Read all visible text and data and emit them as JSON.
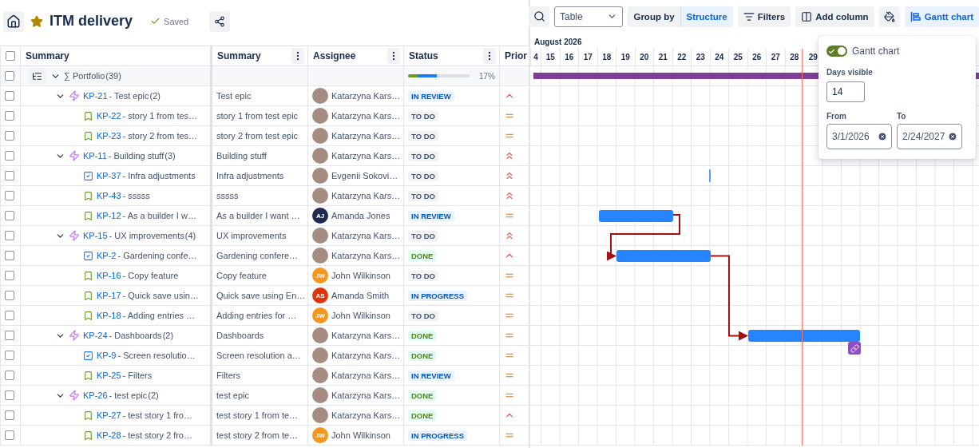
{
  "header": {
    "title": "ITM delivery",
    "starred": true,
    "saved_label": "Saved"
  },
  "toolbar": {
    "view_select": "Table",
    "group_by_label": "Group by",
    "group_by_value": "Structure",
    "filters_label": "Filters",
    "add_column_label": "Add column",
    "gantt_button": {
      "label": "Gantt chart",
      "selected": true
    }
  },
  "table": {
    "header_checked": false,
    "columns": [
      "Summary",
      "Summary",
      "Assignee",
      "Status",
      "Prior"
    ],
    "root": {
      "title": "∑ Portfolio",
      "count": "(39)",
      "checked": false,
      "expanded": true,
      "progress": [
        {
          "kind": "done",
          "level": 0.15
        },
        {
          "kind": "in_progress",
          "level": 0.32
        }
      ],
      "percent": "17%",
      "children": [
        {
          "kind": "epic",
          "key": "KP-21",
          "title": "- Test epic",
          "count": "(2)",
          "summary": "Test epic",
          "assignee": {
            "name": "Katarzyna Kars…",
            "kind": "photo"
          },
          "status": {
            "label": "IN REVIEW",
            "kind": "review"
          },
          "priority": {
            "kind": "high"
          },
          "checked": false,
          "expanded": true,
          "children": [
            {
              "kind": "story",
              "key": "KP-22",
              "title": "- story 1 from tes…",
              "summary": "story 1 from test epic",
              "assignee": {
                "name": "Katarzyna Kars…",
                "kind": "photo"
              },
              "status": {
                "label": "TO DO",
                "kind": "todo"
              },
              "priority": {
                "kind": "medium"
              },
              "checked": false
            },
            {
              "kind": "story",
              "key": "KP-23",
              "title": "- story 2 from tes…",
              "summary": "story 2 from test epic",
              "assignee": {
                "name": "Katarzyna Kars…",
                "kind": "photo"
              },
              "status": {
                "label": "TO DO",
                "kind": "todo"
              },
              "priority": {
                "kind": "medium"
              },
              "checked": false
            }
          ]
        },
        {
          "kind": "epic",
          "key": "KP-11",
          "title": "- Building stuff",
          "count": "(3)",
          "summary": "Building stuff",
          "assignee": {
            "name": "Katarzyna Kars…",
            "kind": "photo"
          },
          "status": {
            "label": "TO DO",
            "kind": "todo"
          },
          "priority": {
            "kind": "highest"
          },
          "checked": false,
          "expanded": true,
          "children": [
            {
              "kind": "task",
              "key": "KP-37",
              "title": "- Infra adjustments",
              "summary": "Infra adjustments",
              "assignee": {
                "name": "Evgenii Sokovi…",
                "kind": "photo"
              },
              "status": {
                "label": "TO DO",
                "kind": "todo"
              },
              "priority": {
                "kind": "highest"
              },
              "checked": false
            },
            {
              "kind": "story",
              "key": "KP-43",
              "title": "- sssss",
              "summary": "sssss",
              "assignee": {
                "name": "Katarzyna Kars…",
                "kind": "photo"
              },
              "status": {
                "label": "TO DO",
                "kind": "todo"
              },
              "priority": {
                "kind": "highest"
              },
              "checked": false
            },
            {
              "kind": "story",
              "key": "KP-12",
              "title": "- As a builder I w…",
              "summary": "As a builder I want …",
              "assignee": {
                "name": "Amanda Jones",
                "kind": "initials",
                "initials": "AJ",
                "color": "#1d2b4f"
              },
              "status": {
                "label": "IN REVIEW",
                "kind": "review"
              },
              "priority": {
                "kind": "medium"
              },
              "checked": false
            }
          ]
        },
        {
          "kind": "epic",
          "key": "KP-15",
          "title": "- UX improvements",
          "count": "(4)",
          "summary": "UX improvements",
          "assignee": {
            "name": "Katarzyna Kars…",
            "kind": "photo"
          },
          "status": {
            "label": "TO DO",
            "kind": "todo"
          },
          "priority": {
            "kind": "highest"
          },
          "checked": false,
          "expanded": true,
          "children": [
            {
              "kind": "task",
              "key": "KP-2",
              "title": "- Gardening confe…",
              "summary": "Gardening confere…",
              "assignee": {
                "name": "Katarzyna Kars…",
                "kind": "photo"
              },
              "status": {
                "label": "DONE",
                "kind": "done"
              },
              "priority": {
                "kind": "high"
              },
              "checked": false
            },
            {
              "kind": "story",
              "key": "KP-16",
              "title": "- Copy feature",
              "summary": "Copy feature",
              "assignee": {
                "name": "John Wilkinson",
                "kind": "initials",
                "initials": "JW",
                "color": "#f5961e"
              },
              "status": {
                "label": "TO DO",
                "kind": "todo"
              },
              "priority": {
                "kind": "medium"
              },
              "checked": false
            },
            {
              "kind": "story",
              "key": "KP-17",
              "title": "- Quick save usin…",
              "summary": "Quick save using En…",
              "assignee": {
                "name": "Amanda Smith",
                "kind": "initials",
                "initials": "AS",
                "color": "#de350b"
              },
              "status": {
                "label": "IN PROGRESS",
                "kind": "progress"
              },
              "priority": {
                "kind": "medium"
              },
              "checked": false
            },
            {
              "kind": "story",
              "key": "KP-18",
              "title": "- Adding entries …",
              "summary": "Adding entries for …",
              "assignee": {
                "name": "John Wilkinson",
                "kind": "initials",
                "initials": "JW",
                "color": "#f5961e"
              },
              "status": {
                "label": "TO DO",
                "kind": "todo"
              },
              "priority": {
                "kind": "medium"
              },
              "checked": false
            }
          ]
        },
        {
          "kind": "epic",
          "key": "KP-24",
          "title": "- Dashboards",
          "count": "(2)",
          "summary": "Dashboards",
          "assignee": {
            "name": "Katarzyna Kars…",
            "kind": "photo"
          },
          "status": {
            "label": "DONE",
            "kind": "done"
          },
          "priority": {
            "kind": "medium"
          },
          "checked": false,
          "expanded": true,
          "children": [
            {
              "kind": "task",
              "key": "KP-9",
              "title": "- Screen resolutio…",
              "summary": "Screen resolution a…",
              "assignee": {
                "name": "Katarzyna Kars…",
                "kind": "photo"
              },
              "status": {
                "label": "DONE",
                "kind": "done"
              },
              "priority": {
                "kind": "medium"
              },
              "checked": false
            },
            {
              "kind": "story",
              "key": "KP-25",
              "title": "- Filters",
              "summary": "Filters",
              "assignee": {
                "name": "Katarzyna Kars…",
                "kind": "photo"
              },
              "status": {
                "label": "IN REVIEW",
                "kind": "review"
              },
              "priority": {
                "kind": "medium"
              },
              "checked": false
            }
          ]
        },
        {
          "kind": "epic",
          "key": "KP-26",
          "title": "- test epic",
          "count": "(2)",
          "summary": "test epic",
          "assignee": {
            "name": "Katarzyna Kars…",
            "kind": "photo"
          },
          "status": {
            "label": "DONE",
            "kind": "done"
          },
          "priority": {
            "kind": "medium"
          },
          "checked": false,
          "expanded": true,
          "children": [
            {
              "kind": "story",
              "key": "KP-27",
              "title": "- test story 1 fro…",
              "summary": "test story 1 from te…",
              "assignee": {
                "name": "Katarzyna Kars…",
                "kind": "photo"
              },
              "status": {
                "label": "DONE",
                "kind": "done"
              },
              "priority": {
                "kind": "high"
              },
              "checked": false
            },
            {
              "kind": "story",
              "key": "KP-28",
              "title": "- test story 2 fro…",
              "summary": "test story 2 from te…",
              "assignee": {
                "name": "John Wilkinson",
                "kind": "initials",
                "initials": "JW",
                "color": "#f5961e"
              },
              "status": {
                "label": "IN PROGRESS",
                "kind": "progress"
              },
              "priority": {
                "kind": "medium"
              },
              "checked": false
            }
          ]
        }
      ]
    }
  },
  "gantt": {
    "month": "August 2026",
    "days": [
      "4",
      "15",
      "16",
      "17",
      "18",
      "19",
      "20",
      "21",
      "22",
      "23",
      "24",
      "25",
      "26",
      "27",
      "28",
      "29"
    ]
  },
  "gantt_settings": {
    "enabled": true,
    "label": "Gantt chart",
    "days_visible_label": "Days visible",
    "days_visible": "14",
    "from_label": "From",
    "from": "3/1/2026",
    "to_label": "To",
    "to": "2/24/2027"
  }
}
